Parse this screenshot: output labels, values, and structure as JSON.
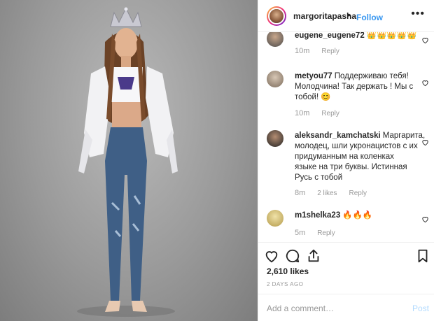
{
  "header": {
    "username": "margoritapasha",
    "dot": "•",
    "follow_label": "Follow",
    "more_label": "•••"
  },
  "comments": [
    {
      "user": "eugene_eugene72",
      "text": "👑👑👑👑👑",
      "time": "10m",
      "reply": "Reply",
      "likes": ""
    },
    {
      "user": "metyou77",
      "text": "Поддерживаю тебя! Молодчина! Так держать ! Мы с тобой! 😊",
      "time": "10m",
      "reply": "Reply",
      "likes": ""
    },
    {
      "user": "aleksandr_kamchatski",
      "text": "Маргарита, молодец, шли укронацистов с их придуманным на коленках языке на три буквы. Истинная Русь с тобой",
      "time": "8m",
      "reply": "Reply",
      "likes": "2 likes"
    },
    {
      "user": "m1shelka23",
      "text": "🔥🔥🔥",
      "time": "5m",
      "reply": "Reply",
      "likes": ""
    }
  ],
  "post": {
    "likes": "2,610 likes",
    "date": "2 DAYS AGO"
  },
  "add_comment": {
    "placeholder": "Add a comment…",
    "post_label": "Post"
  },
  "colors": {
    "link": "#3897f0",
    "muted": "#999999",
    "post_disabled": "#b3dbff"
  },
  "icons": [
    "heart-icon",
    "comment-icon",
    "share-icon",
    "bookmark-icon",
    "more-icon"
  ]
}
